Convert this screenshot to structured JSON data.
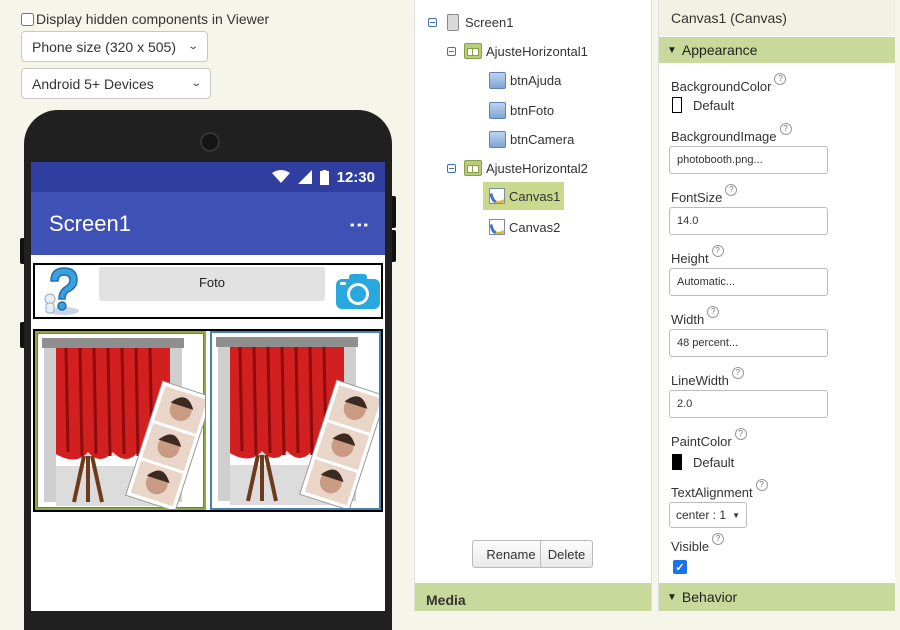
{
  "viewer": {
    "hidden_label": "Display hidden components in Viewer",
    "phone_size": "Phone size (320 x 505)",
    "device": "Android 5+ Devices",
    "status_time": "12:30",
    "screen_title": "Screen1",
    "foto_button": "Foto"
  },
  "tree": {
    "nodes": [
      "Screen1",
      "AjusteHorizontal1",
      "btnAjuda",
      "btnFoto",
      "btnCamera",
      "AjusteHorizontal2",
      "Canvas1",
      "Canvas2"
    ],
    "rename": "Rename",
    "delete": "Delete",
    "media": "Media"
  },
  "props": {
    "title": "Canvas1 (Canvas)",
    "appearance": "Appearance",
    "behavior": "Behavior",
    "background_color_label": "BackgroundColor",
    "background_color_value": "Default",
    "background_image_label": "BackgroundImage",
    "background_image_value": "photobooth.png...",
    "fontsize_label": "FontSize",
    "fontsize_value": "14.0",
    "height_label": "Height",
    "height_value": "Automatic...",
    "width_label": "Width",
    "width_value": "48 percent...",
    "linewidth_label": "LineWidth",
    "linewidth_value": "2.0",
    "paintcolor_label": "PaintColor",
    "paintcolor_value": "Default",
    "textalign_label": "TextAlignment",
    "textalign_value": "center : 1",
    "visible_label": "Visible",
    "help_mark": "?"
  },
  "colors": {
    "status_bar": "#303f9f",
    "app_bar": "#3f51b5",
    "section_header": "#c8d99b",
    "selected_node": "#cad98e"
  }
}
